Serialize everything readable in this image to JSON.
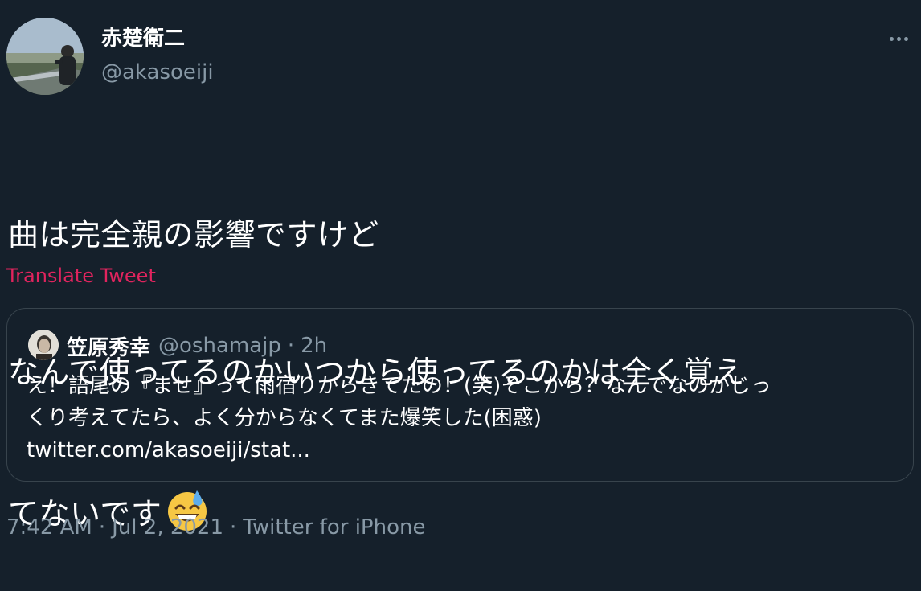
{
  "author": {
    "display_name": "赤楚衛二",
    "handle": "@akasoeiji"
  },
  "tweet": {
    "lines": [
      "曲は完全親の影響ですけど",
      "なんで使ってるのかいつから使ってるのかは全く覚え",
      "てないです"
    ],
    "emoji": "grinning-face-with-sweat-emoji"
  },
  "translate_label": "Translate Tweet",
  "quote": {
    "name": "笠原秀幸",
    "handle": "@oshamajp",
    "separator": "·",
    "time": "2h",
    "lines": [
      "え！語尾の『ませ』って雨宿りからきてたの！(笑)そこから？なんでなのかじっ",
      "くり考えてたら、よく分からなくてまた爆笑した(困惑)",
      "twitter.com/akasoeiji/stat..."
    ]
  },
  "meta": {
    "time": "7:42 AM",
    "separator": "·",
    "date": "Jul 2, 2021",
    "source": "Twitter for iPhone"
  },
  "colors": {
    "background": "#15202b",
    "secondary_text": "#8899a6",
    "translate_link": "#e0245e",
    "border": "#38444d"
  }
}
